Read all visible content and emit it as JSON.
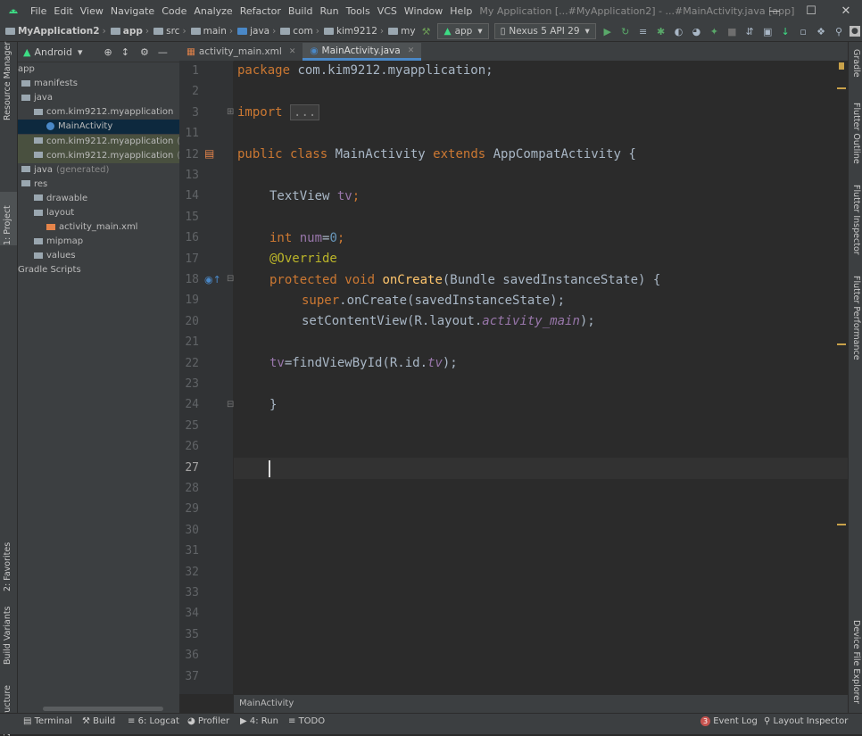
{
  "menu": {
    "items": [
      "File",
      "Edit",
      "View",
      "Navigate",
      "Code",
      "Analyze",
      "Refactor",
      "Build",
      "Run",
      "Tools",
      "VCS",
      "Window",
      "Help"
    ],
    "window_title": "My Application [...#MyApplication2] - ...#MainActivity.java [app]"
  },
  "navbar": {
    "breadcrumbs": [
      "MyApplication2",
      "app",
      "src",
      "main",
      "java",
      "com",
      "kim9212",
      "my"
    ],
    "run_config": "app",
    "device": "Nexus 5 API 29"
  },
  "project_panel": {
    "view_mode": "Android",
    "tree": [
      {
        "label": "app",
        "indent": 0
      },
      {
        "label": "manifests",
        "indent": 1
      },
      {
        "label": "java",
        "indent": 1
      },
      {
        "label": "com.kim9212.myapplication",
        "indent": 2
      },
      {
        "label": "MainActivity",
        "indent": 3,
        "selected": true
      },
      {
        "label": "com.kim9212.myapplication",
        "suffix": "(androidTest)",
        "indent": 2,
        "highlight": true
      },
      {
        "label": "com.kim9212.myapplication",
        "suffix": "(test)",
        "indent": 2,
        "highlight": true
      },
      {
        "label": "java",
        "suffix": "(generated)",
        "indent": 1
      },
      {
        "label": "res",
        "indent": 1
      },
      {
        "label": "drawable",
        "indent": 2
      },
      {
        "label": "layout",
        "indent": 2
      },
      {
        "label": "activity_main.xml",
        "indent": 3
      },
      {
        "label": "mipmap",
        "indent": 2
      },
      {
        "label": "values",
        "indent": 2
      },
      {
        "label": "Gradle Scripts",
        "indent": 0
      }
    ]
  },
  "left_strip_tabs": [
    "Resource Manager",
    "1: Project",
    "2: Favorites",
    "Build Variants",
    "Z: Structure"
  ],
  "right_strip_tabs": [
    "Gradle",
    "Flutter Outline",
    "Flutter Inspector",
    "Flutter Performance",
    "Device File Explorer"
  ],
  "editor": {
    "tabs": [
      {
        "label": "activity_main.xml",
        "active": false
      },
      {
        "label": "MainActivity.java",
        "active": true
      }
    ],
    "line_numbers": [
      "1",
      "2",
      "3",
      "11",
      "12",
      "13",
      "14",
      "15",
      "16",
      "17",
      "18",
      "19",
      "20",
      "21",
      "22",
      "23",
      "24",
      "25",
      "26",
      "27",
      "28",
      "29",
      "30",
      "31",
      "32",
      "33",
      "34",
      "35",
      "36",
      "37"
    ],
    "code": {
      "l1_kw": "package",
      "l1_rest": " com.kim9212.myapplication;",
      "l3_kw": "import",
      "l3_fold": "...",
      "l12_kw": "public class",
      "l12_name": " MainActivity ",
      "l12_kw2": "extends",
      "l12_rest": " AppCompatActivity {",
      "l14": "TextView ",
      "l14_field": "tv",
      "l14_end": ";",
      "l16_kw": "int",
      "l16_field": " num",
      "l16_eq": "=",
      "l16_num": "0",
      "l16_end": ";",
      "l17": "@Override",
      "l18_kw": "protected void",
      "l18_fn": " onCreate",
      "l18_rest": "(Bundle savedInstanceState) {",
      "l19_kw": "super",
      "l19_rest": ".onCreate(savedInstanceState);",
      "l20_a": "setContentView(R.layout.",
      "l20_it": "activity_main",
      "l20_b": ");",
      "l22_field": "tv",
      "l22_a": "=findViewById(R.id.",
      "l22_it": "tv",
      "l22_b": ");",
      "l24": "}"
    },
    "breadcrumb": "MainActivity"
  },
  "bottom_bar": {
    "terminal": "Terminal",
    "build": "Build",
    "logcat": "6: Logcat",
    "profiler": "Profiler",
    "run": "4: Run",
    "todo": "TODO",
    "event_log_count": "3",
    "event_log": "Event Log",
    "layout_inspector": "Layout Inspector"
  },
  "colors": {
    "keyword": "#cc7832",
    "function": "#ffc66d",
    "annotation": "#bbb529",
    "number": "#6897bb",
    "field": "#9876aa",
    "text": "#a9b7c6",
    "error_badge": "#c75450"
  }
}
